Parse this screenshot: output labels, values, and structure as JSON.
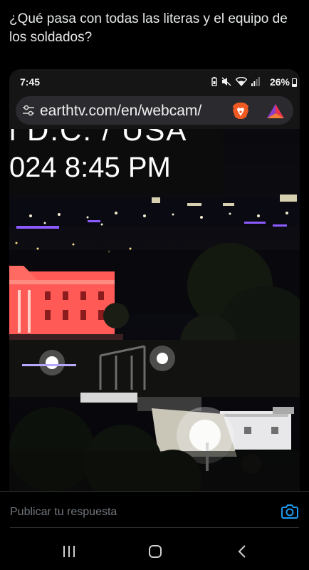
{
  "post": {
    "text": "¿Qué pasa con todas las literas y el equipo de los soldados?"
  },
  "phone_screenshot": {
    "status_time": "7:45",
    "battery_text": "26%",
    "url_text": "earthtv.com/en/webcam/",
    "webcam_overlay_line1": "l D.C. / USA",
    "webcam_overlay_line2": "024 8:45 PM"
  },
  "reply": {
    "placeholder": "Publicar tu respuesta"
  },
  "icons": {
    "reply_camera": "camera-icon",
    "nav_recents": "recents-icon",
    "nav_home": "home-icon",
    "nav_back": "back-icon"
  },
  "colors": {
    "background": "#000000",
    "text": "#e7e9ea",
    "muted": "#71767b",
    "accent": "#1d9bf0",
    "white_house_light": "#ff5a55"
  }
}
